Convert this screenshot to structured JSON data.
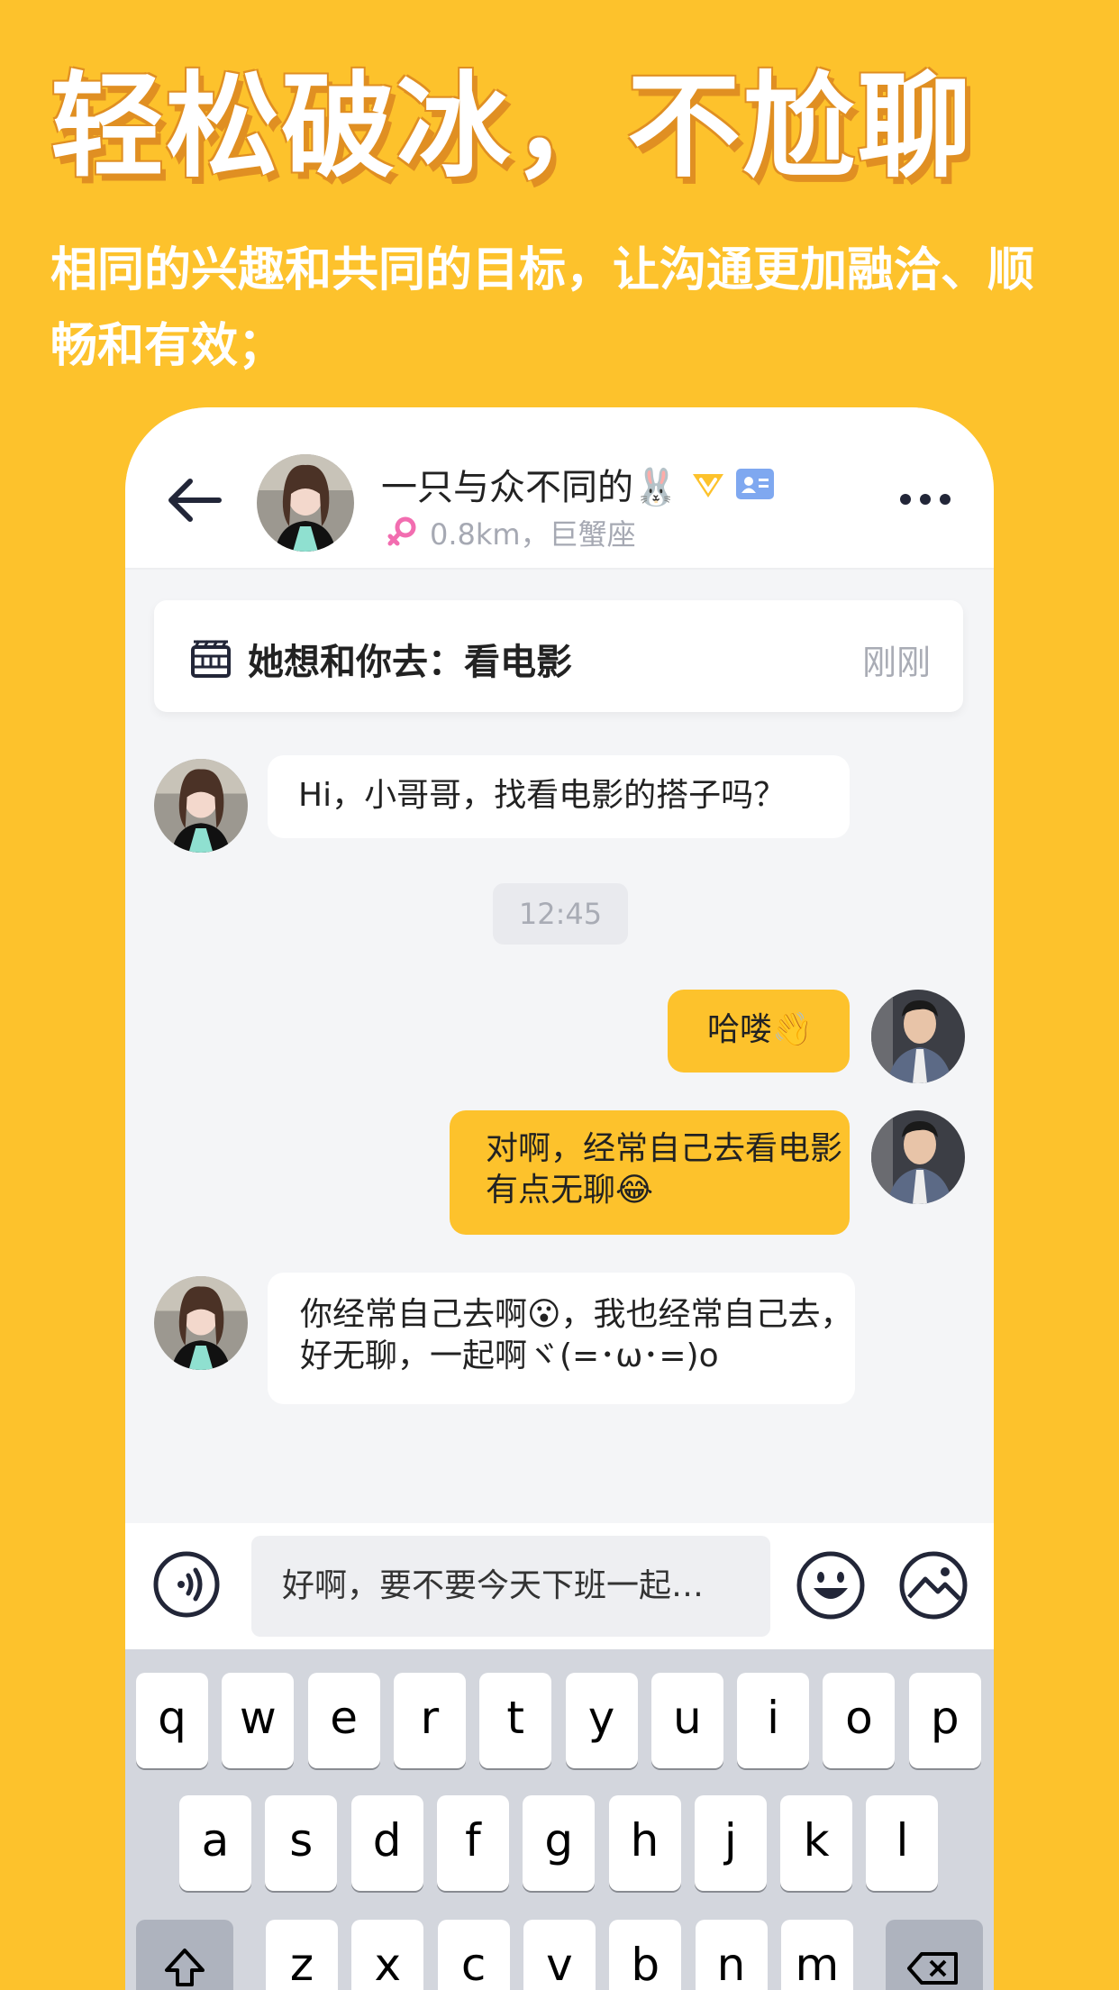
{
  "promo": {
    "headline": "轻松破冰，不尬聊",
    "subline": "相同的兴趣和共同的目标，让沟通更加融洽、顺畅和有效；"
  },
  "chat_header": {
    "name": "一只与众不同的🐰",
    "distance_sign": "0.8km，巨蟹座"
  },
  "activity": {
    "text": "她想和你去：看电影",
    "time": "刚刚"
  },
  "messages": [
    {
      "side": "left",
      "text": "Hi，小哥哥，找看电影的搭子吗？"
    },
    {
      "side": "time",
      "text": "12:45"
    },
    {
      "side": "right",
      "text": "哈喽👋"
    },
    {
      "side": "right",
      "text": "对啊，经常自己去看电影有点无聊😂"
    },
    {
      "side": "left",
      "text": "你经常自己去啊😮，我也经常自己去，好无聊，一起啊ヾ(=･ω･=)o"
    }
  ],
  "input": {
    "value": "好啊，要不要今天下班一起…"
  },
  "keyboard": {
    "row1": [
      "q",
      "w",
      "e",
      "r",
      "t",
      "y",
      "u",
      "i",
      "o",
      "p"
    ],
    "row2": [
      "a",
      "s",
      "d",
      "f",
      "g",
      "h",
      "j",
      "k",
      "l"
    ],
    "row3": [
      "z",
      "x",
      "c",
      "v",
      "b",
      "n",
      "m"
    ]
  },
  "colors": {
    "brand": "#FDC22C",
    "shadow": "#E08F22"
  }
}
